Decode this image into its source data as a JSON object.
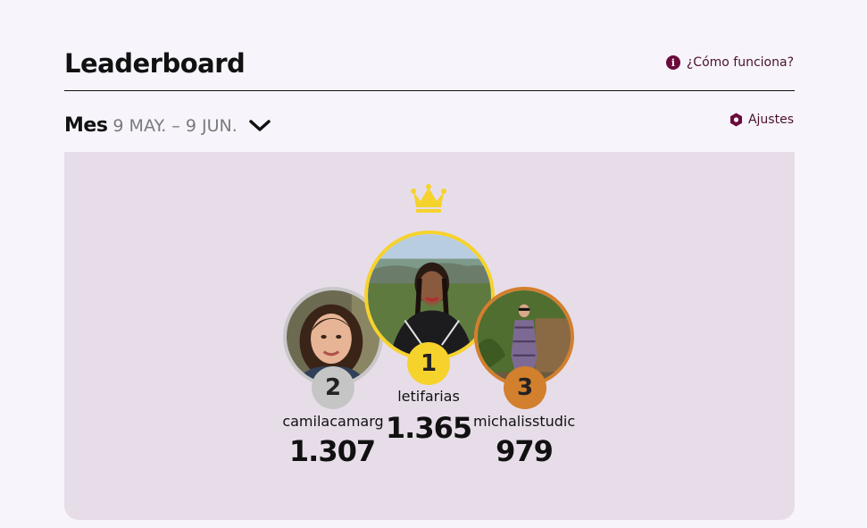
{
  "header": {
    "title": "Leaderboard",
    "help_link": "¿Cómo funciona?",
    "help_icon": "info-icon"
  },
  "period": {
    "label": "Mes",
    "range": "9 MAY. – 9 JUN.",
    "dropdown_icon": "chevron-down-icon"
  },
  "settings": {
    "label": "Ajustes",
    "icon": "hexagon-icon"
  },
  "podium": [
    {
      "rank": "1",
      "username": "letifarias",
      "score": "1.365",
      "ring_color": "#f6d22c"
    },
    {
      "rank": "2",
      "username": "camilacamarg",
      "score": "1.307",
      "ring_color": "#c9c7c9"
    },
    {
      "rank": "3",
      "username": "michalisstudic",
      "score": "979",
      "ring_color": "#d27f2e"
    }
  ],
  "colors": {
    "accent": "#6b0b3c",
    "panel_bg": "#e7dde9",
    "gold": "#f6d22c",
    "silver": "#c6c5c6",
    "bronze": "#d27f2e"
  }
}
